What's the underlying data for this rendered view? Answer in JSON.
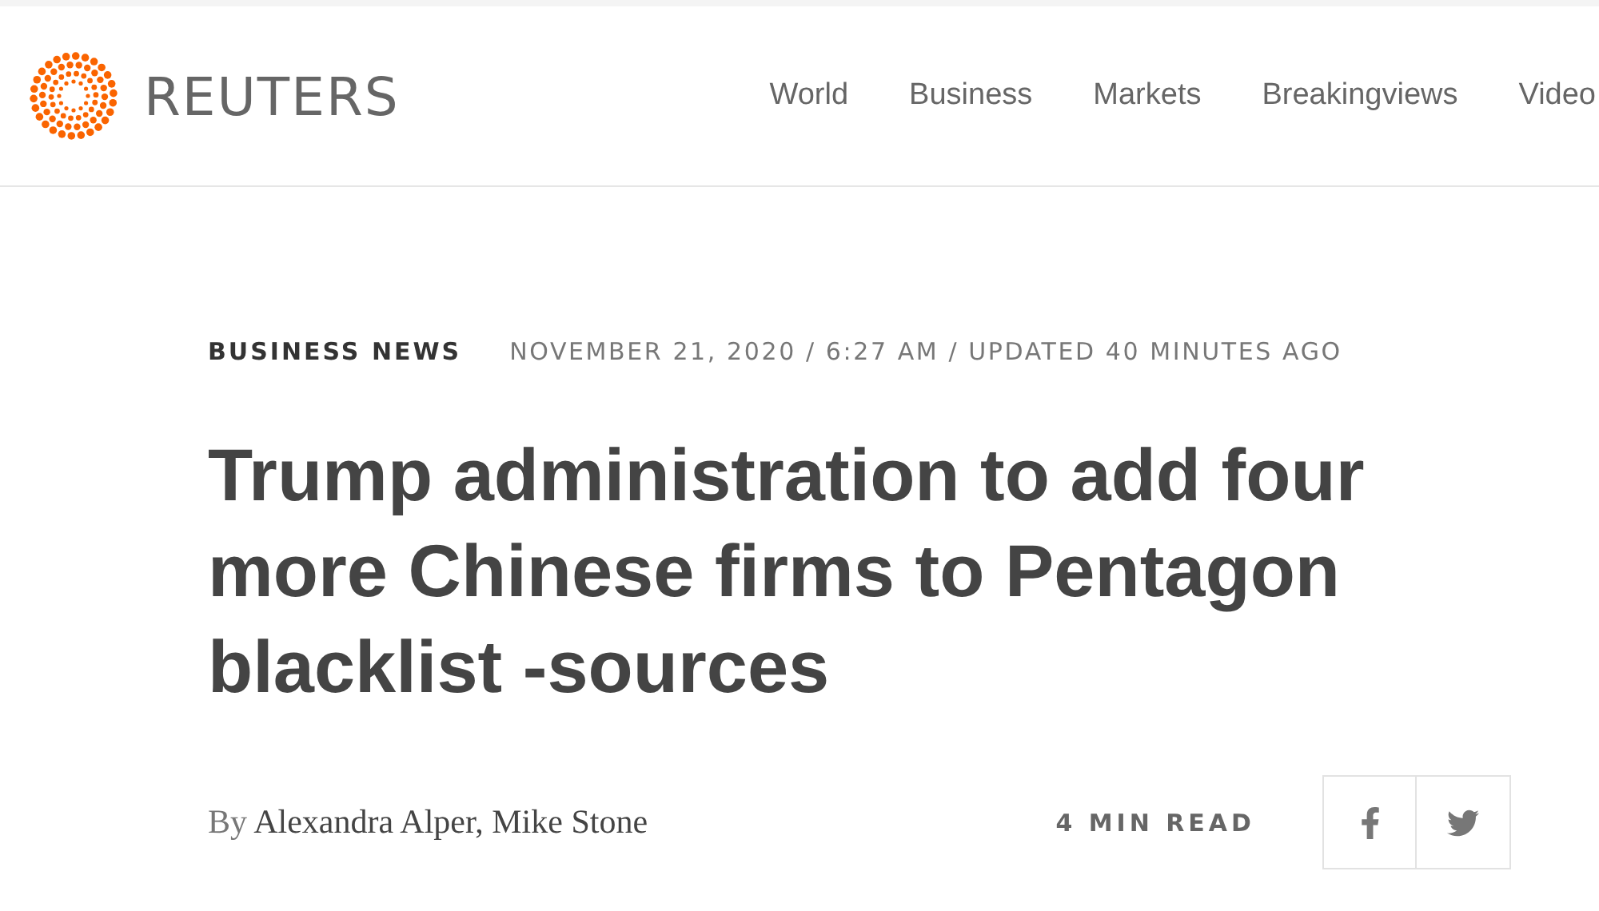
{
  "header": {
    "logo_text": "REUTERS",
    "nav": [
      {
        "label": "World"
      },
      {
        "label": "Business"
      },
      {
        "label": "Markets"
      },
      {
        "label": "Breakingviews"
      },
      {
        "label": "Video"
      }
    ]
  },
  "article": {
    "section": "BUSINESS NEWS",
    "dateline": "NOVEMBER 21, 2020 / 6:27 AM / UPDATED 40 MINUTES AGO",
    "headline": "Trump administration to add four more Chinese firms to Pentagon blacklist -sources",
    "byline_prefix": "By",
    "authors": "Alexandra Alper, Mike Stone",
    "read_time": "4 MIN READ"
  }
}
